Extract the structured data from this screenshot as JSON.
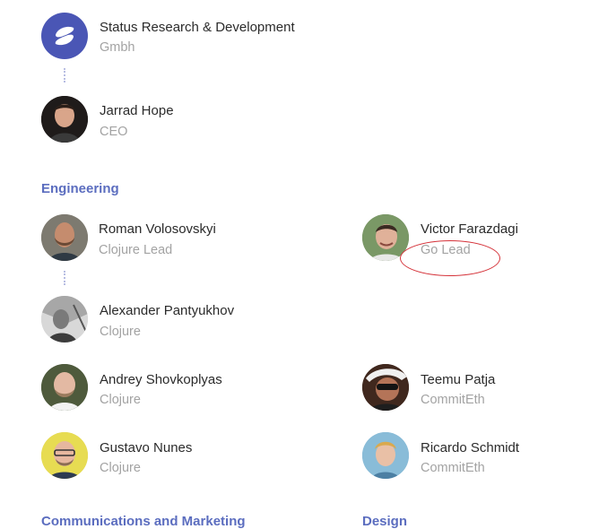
{
  "company": {
    "name": "Status Research & Development",
    "subtitle": "Gmbh",
    "logo_color": "#4a56b5",
    "icon": "status-logo-icon"
  },
  "ceo": {
    "name": "Jarrad Hope",
    "role": "CEO"
  },
  "engineering": {
    "title": "Engineering",
    "people": [
      {
        "name": "Roman Volosovskyi",
        "role": "Clojure Lead"
      },
      {
        "name": "Victor Farazdagi",
        "role": "Go Lead"
      },
      {
        "name": "Alexander Pantyukhov",
        "role": "Clojure"
      },
      {
        "name": "Andrey Shovkoplyas",
        "role": "Clojure"
      },
      {
        "name": "Teemu Patja",
        "role": "CommitEth"
      },
      {
        "name": "Gustavo Nunes",
        "role": "Clojure"
      },
      {
        "name": "Ricardo Schmidt",
        "role": "CommitEth"
      }
    ]
  },
  "next_sections": {
    "left": "Communications and Marketing",
    "right": "Design"
  },
  "colors": {
    "accent": "#5b6dbf",
    "annotation": "#d5333a"
  }
}
